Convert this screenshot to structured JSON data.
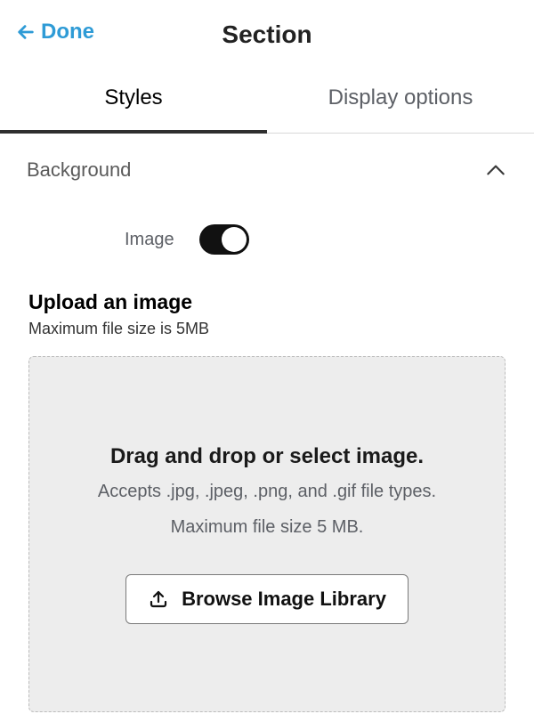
{
  "header": {
    "back_label": "Done",
    "title": "Section"
  },
  "tabs": {
    "styles": "Styles",
    "display_options": "Display options",
    "active": "styles"
  },
  "background": {
    "section_label": "Background",
    "expanded": true,
    "image_toggle_label": "Image",
    "image_toggle_on": true
  },
  "upload": {
    "heading": "Upload an image",
    "subheading": "Maximum file size is 5MB",
    "dropzone_title": "Drag and drop or select image.",
    "dropzone_line_a": "Accepts .jpg, .jpeg, .png, and .gif file types.",
    "dropzone_line_b": "Maximum file size 5 MB.",
    "browse_label": "Browse Image Library"
  },
  "colors": {
    "accent": "#2e9bd6"
  }
}
